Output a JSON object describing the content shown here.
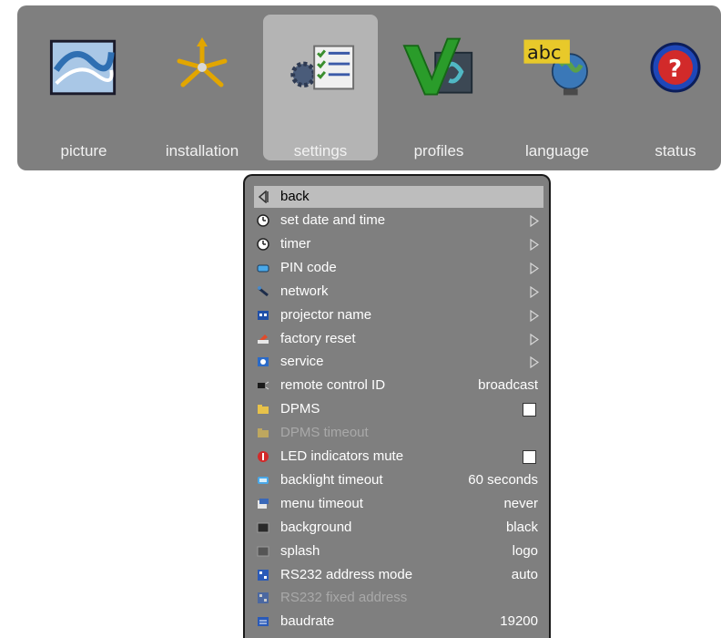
{
  "tabs": [
    {
      "label": "picture",
      "icon": "picture-icon"
    },
    {
      "label": "installation",
      "icon": "installation-icon"
    },
    {
      "label": "settings",
      "icon": "settings-icon",
      "selected": true
    },
    {
      "label": "profiles",
      "icon": "profiles-icon"
    },
    {
      "label": "language",
      "icon": "language-icon"
    },
    {
      "label": "status",
      "icon": "status-icon"
    }
  ],
  "language_icon_text": "abc",
  "status_icon_text": "?",
  "menu": {
    "back": "back",
    "items": [
      {
        "label": "set date and time",
        "arrow": true,
        "icon": "clock-icon"
      },
      {
        "label": "timer",
        "arrow": true,
        "icon": "clock-icon"
      },
      {
        "label": "PIN code",
        "arrow": true,
        "icon": "pin-icon"
      },
      {
        "label": "network",
        "arrow": true,
        "icon": "network-icon"
      },
      {
        "label": "projector name",
        "arrow": true,
        "icon": "name-icon"
      },
      {
        "label": "factory reset",
        "arrow": true,
        "icon": "reset-icon"
      },
      {
        "label": "service",
        "arrow": true,
        "icon": "service-icon"
      },
      {
        "label": "remote control ID",
        "value": "broadcast",
        "icon": "remote-icon"
      },
      {
        "label": "DPMS",
        "checkbox": true,
        "icon": "folder-icon"
      },
      {
        "label": "DPMS timeout",
        "disabled": true,
        "icon": "folder-icon"
      },
      {
        "label": "LED indicators mute",
        "checkbox": true,
        "icon": "led-icon"
      },
      {
        "label": "backlight timeout",
        "value": "60 seconds",
        "icon": "backlight-icon"
      },
      {
        "label": "menu timeout",
        "value": "never",
        "icon": "menu-icon"
      },
      {
        "label": "background",
        "value": "black",
        "icon": "background-icon"
      },
      {
        "label": "splash",
        "value": "logo",
        "icon": "splash-icon"
      },
      {
        "label": "RS232 address mode",
        "value": "auto",
        "icon": "rs232-icon"
      },
      {
        "label": "RS232 fixed address",
        "disabled": true,
        "icon": "rs232-icon"
      },
      {
        "label": "baudrate",
        "value": "19200",
        "icon": "baudrate-icon"
      }
    ]
  }
}
